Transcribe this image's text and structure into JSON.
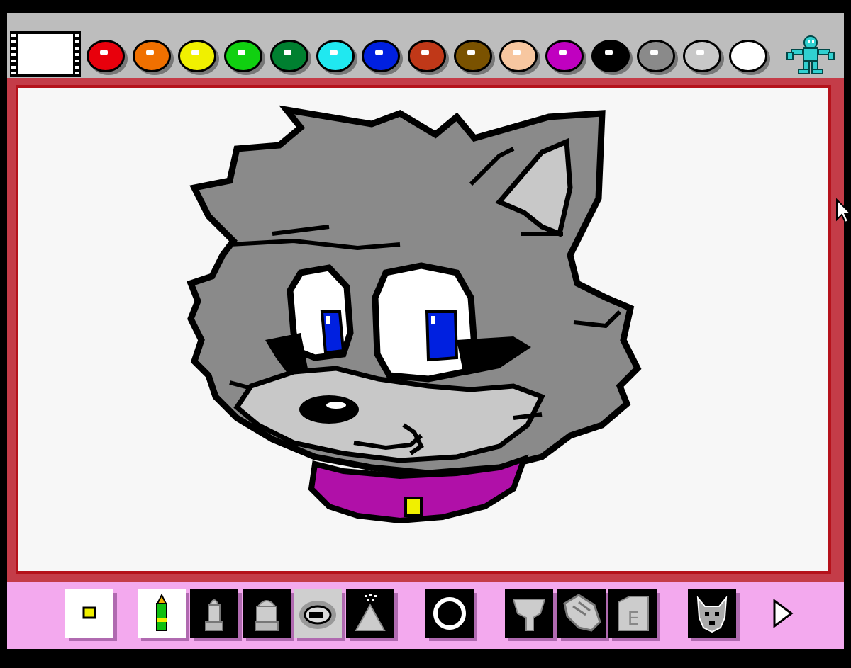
{
  "palette": {
    "current_color": "#ffffff",
    "colors": [
      "#e8000c",
      "#f07000",
      "#f0f000",
      "#10d010",
      "#008030",
      "#20e8f0",
      "#0020e0",
      "#c03818",
      "#7a5200",
      "#f7c7a0",
      "#c000c0",
      "#000000",
      "#8a8a8a",
      "#c8c8c8",
      "#ffffff"
    ]
  },
  "stamp_icon": "alien-stamp-icon",
  "canvas": {
    "background": "#f7f7f7",
    "border_color": "#b5121b"
  },
  "drawing": {
    "subject": "gray-wolf-head",
    "fur_color": "#8a8a8a",
    "muzzle_color": "#c8c8c8",
    "eye_color": "#0020e0",
    "collar_color": "#b010a8",
    "tag_color": "#f0f000"
  },
  "toolbar": {
    "tools": [
      {
        "icon": "small-square-brush-icon"
      },
      {
        "icon": "crayon-icon"
      },
      {
        "icon": "marker-icon"
      },
      {
        "icon": "marker-wide-icon"
      },
      {
        "icon": "spray-brush-icon"
      },
      {
        "icon": "spray-can-icon"
      },
      {
        "icon": "circle-shape-icon"
      },
      {
        "icon": "paint-bucket-icon"
      },
      {
        "icon": "hand-icon"
      },
      {
        "icon": "eraser-icon"
      },
      {
        "icon": "dog-stamp-icon"
      },
      {
        "icon": "next-arrow-icon"
      }
    ]
  }
}
